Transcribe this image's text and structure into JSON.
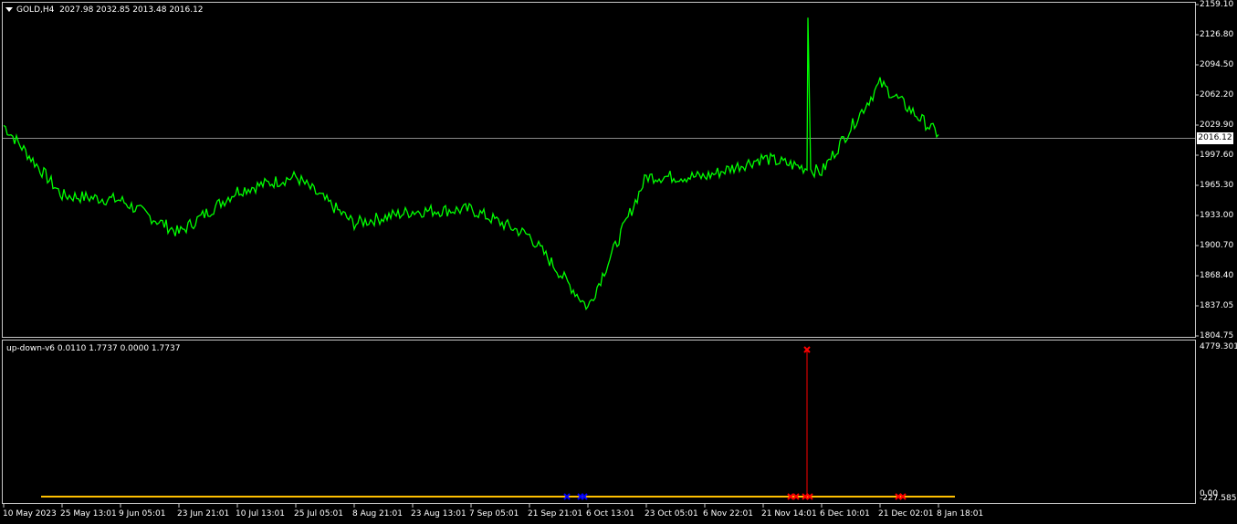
{
  "symbol_header": "GOLD,H4  2027.98 2032.85 2013.48 2016.12",
  "indicator_header": "up-down-v6 0.0110 1.7737 0.0000 1.7737",
  "price_axis": [
    "2159.10",
    "2126.80",
    "2094.50",
    "2062.20",
    "2029.90",
    "1997.60",
    "1965.30",
    "1933.00",
    "1900.70",
    "1868.40",
    "1837.05",
    "1804.75"
  ],
  "current_price": "2016.12",
  "indicator_axis": {
    "top": "4779.3018",
    "zero": "0.00",
    "bottom": "-227.5858"
  },
  "time_axis": [
    "10 May 2023",
    "25 May 13:01",
    "9 Jun 05:01",
    "23 Jun 21:01",
    "10 Jul 13:01",
    "25 Jul 05:01",
    "8 Aug 21:01",
    "23 Aug 13:01",
    "7 Sep 05:01",
    "21 Sep 21:01",
    "6 Oct 13:01",
    "23 Oct 05:01",
    "6 Nov 22:01",
    "21 Nov 14:01",
    "6 Dec 10:01",
    "21 Dec 02:01",
    "8 Jan 18:01"
  ],
  "colors": {
    "price_line": "#00ff00",
    "buy_marker": "#0000ff",
    "sell_marker": "#ff0000",
    "indicator_line": "#ffc000",
    "frame": "#c8c8c8"
  },
  "chart_data": {
    "type": "line",
    "title": "GOLD,H4",
    "series": [
      {
        "name": "GOLD",
        "x": [
          "10 May 2023",
          "25 May 13:01",
          "9 Jun 05:01",
          "23 Jun 21:01",
          "10 Jul 13:01",
          "25 Jul 05:01",
          "8 Aug 21:01",
          "23 Aug 13:01",
          "7 Sep 05:01",
          "21 Sep 21:01",
          "6 Oct 13:01",
          "23 Oct 05:01",
          "6 Nov 22:01",
          "21 Nov 14:01",
          "6 Dec 10:01",
          "21 Dec 02:01",
          "8 Jan 18:01"
        ],
        "values": [
          2030,
          1955,
          1950,
          1915,
          1960,
          1975,
          1925,
          1938,
          1940,
          1912,
          1835,
          1975,
          1975,
          1995,
          1980,
          2075,
          2020
        ]
      }
    ],
    "ylim": [
      1804.75,
      2159.1
    ]
  }
}
